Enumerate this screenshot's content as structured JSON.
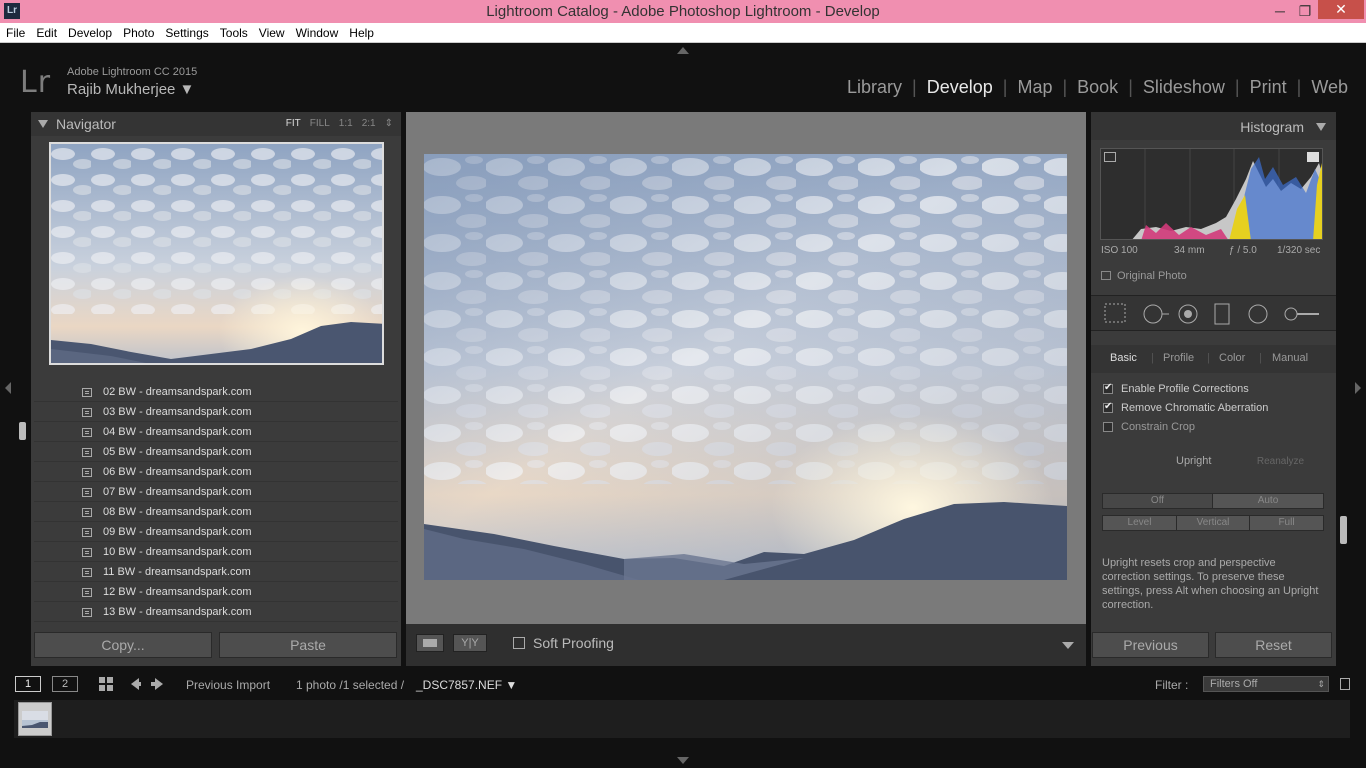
{
  "window": {
    "app_badge": "Lr",
    "title": "Lightroom Catalog - Adobe Photoshop Lightroom - Develop",
    "minimize": "─",
    "maximize": "❐",
    "close": "✕"
  },
  "menu": [
    "File",
    "Edit",
    "Develop",
    "Photo",
    "Settings",
    "Tools",
    "View",
    "Window",
    "Help"
  ],
  "identity": {
    "logo": "Lr",
    "product": "Adobe Lightroom CC 2015",
    "user": "Rajib Mukherjee ▼"
  },
  "modules": [
    "Library",
    "Develop",
    "Map",
    "Book",
    "Slideshow",
    "Print",
    "Web"
  ],
  "active_module": "Develop",
  "navigator": {
    "title": "Navigator",
    "zoom": [
      "FIT",
      "FILL",
      "1:1",
      "2:1"
    ],
    "zoom_arrows": "⇕"
  },
  "presets": [
    "02 BW - dreamsandspark.com",
    "03 BW - dreamsandspark.com",
    "04 BW - dreamsandspark.com",
    "05 BW - dreamsandspark.com",
    "06 BW - dreamsandspark.com",
    "07 BW - dreamsandspark.com",
    "08 BW - dreamsandspark.com",
    "09 BW - dreamsandspark.com",
    "10 BW - dreamsandspark.com",
    "11 BW - dreamsandspark.com",
    "12 BW - dreamsandspark.com",
    "13 BW - dreamsandspark.com"
  ],
  "left_buttons": {
    "copy": "Copy...",
    "paste": "Paste"
  },
  "toolbar": {
    "yy": "Y|Y",
    "soft_proofing": "Soft Proofing"
  },
  "histogram": {
    "title": "Histogram",
    "iso": "ISO 100",
    "focal": "34 mm",
    "aperture": "ƒ / 5.0",
    "shutter": "1/320 sec",
    "original_photo": "Original Photo"
  },
  "lens_tabs": [
    "Basic",
    "Profile",
    "Color",
    "Manual"
  ],
  "lens_active_tab": "Basic",
  "lens": {
    "enable_profile": "Enable Profile Corrections",
    "remove_ca": "Remove Chromatic Aberration",
    "constrain_crop": "Constrain Crop",
    "enable_profile_checked": true,
    "remove_ca_checked": true,
    "constrain_crop_checked": false,
    "upright": "Upright",
    "reanalyze": "Reanalyze",
    "off": "Off",
    "auto": "Auto",
    "level": "Level",
    "vertical": "Vertical",
    "full": "Full",
    "help": "Upright resets crop and perspective correction settings. To preserve these settings, press Alt when choosing an Upright correction."
  },
  "right_buttons": {
    "previous": "Previous",
    "reset": "Reset"
  },
  "filmbar": {
    "page1": "1",
    "page2": "2",
    "source": "Previous Import",
    "selection": "1 photo /1 selected /",
    "filename": "_DSC7857.NEF ▼",
    "filter_label": "Filter :",
    "filter_value": "Filters Off"
  }
}
